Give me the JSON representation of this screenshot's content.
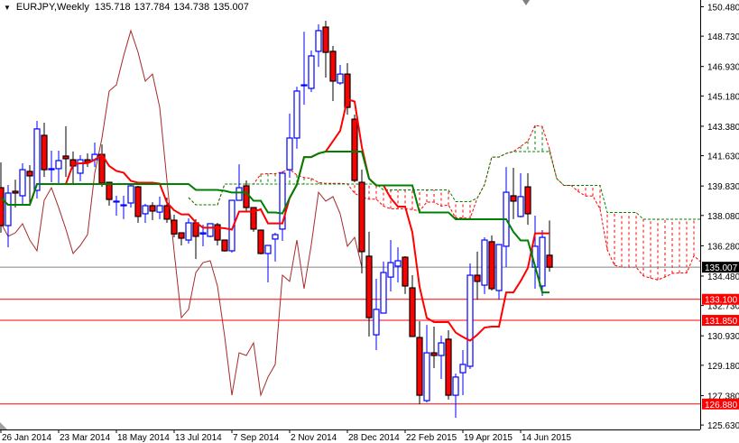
{
  "header": {
    "symbol": "EURJPY,Weekly",
    "open": "135.718",
    "high": "137.784",
    "low": "134.738",
    "close": "135.007"
  },
  "colors": {
    "bull": "#0000ff",
    "bear_fill": "#ff0000",
    "tenkan": "#ff0000",
    "kijun": "#008000",
    "chikou": "#a52a2a",
    "cloud_up": "#008000",
    "cloud_down": "#ff0000",
    "level": "#ff0000",
    "price_line": "#808080"
  },
  "chart_data": {
    "type": "candlestick",
    "title": "EURJPY,Weekly",
    "indicator": "Ichimoku Kinko Hyo",
    "ylim": [
      125.63,
      150.48
    ],
    "y_ticks": [
      "150.480",
      "148.730",
      "146.930",
      "145.180",
      "143.380",
      "141.630",
      "139.830",
      "138.080",
      "136.280",
      "134.480",
      "132.730",
      "130.930",
      "129.180",
      "127.380",
      "125.630"
    ],
    "x_labels": [
      {
        "index": 0,
        "label": "26 Jan 2014"
      },
      {
        "index": 8,
        "label": "23 Mar 2014"
      },
      {
        "index": 16,
        "label": "18 May 2014"
      },
      {
        "index": 24,
        "label": "13 Jul 2014"
      },
      {
        "index": 32,
        "label": "7 Sep 2014"
      },
      {
        "index": 40,
        "label": "2 Nov 2014"
      },
      {
        "index": 48,
        "label": "28 Dec 2014"
      },
      {
        "index": 56,
        "label": "22 Feb 2015"
      },
      {
        "index": 64,
        "label": "19 Apr 2015"
      },
      {
        "index": 72,
        "label": "14 Jun 2015"
      }
    ],
    "current_price": "135.007",
    "levels": [
      "133.100",
      "131.850",
      "126.880"
    ],
    "ohlc": [
      [
        139.73,
        141.23,
        137.05,
        137.48
      ],
      [
        137.48,
        139.89,
        136.19,
        139.41
      ],
      [
        139.52,
        140.21,
        138.55,
        139.41
      ],
      [
        139.25,
        141.18,
        138.71,
        140.8
      ],
      [
        140.7,
        141.07,
        138.66,
        140.43
      ],
      [
        139.57,
        143.7,
        139.09,
        143.22
      ],
      [
        142.84,
        143.59,
        140.37,
        140.8
      ],
      [
        140.8,
        141.93,
        140.05,
        140.86
      ],
      [
        140.86,
        141.93,
        139.89,
        141.34
      ],
      [
        141.61,
        143.38,
        140.37,
        141.45
      ],
      [
        141.39,
        141.88,
        139.99,
        141.02
      ],
      [
        140.59,
        141.66,
        140.11,
        141.39
      ],
      [
        141.39,
        141.77,
        140.96,
        141.23
      ],
      [
        141.39,
        142.41,
        140.96,
        141.71
      ],
      [
        141.71,
        142.3,
        139.78,
        139.99
      ],
      [
        140.05,
        140.05,
        138.66,
        139.03
      ],
      [
        138.93,
        139.25,
        138.07,
        138.93
      ],
      [
        138.71,
        139.25,
        137.86,
        138.71
      ],
      [
        138.82,
        139.99,
        138.55,
        139.84
      ],
      [
        139.78,
        139.84,
        137.64,
        138.02
      ],
      [
        138.18,
        138.77,
        137.64,
        138.66
      ],
      [
        138.66,
        138.87,
        137.8,
        138.34
      ],
      [
        138.28,
        139.2,
        137.86,
        138.66
      ],
      [
        138.66,
        139.14,
        137.64,
        137.86
      ],
      [
        137.8,
        138.12,
        136.78,
        136.98
      ],
      [
        137.05,
        137.05,
        136.3,
        136.73
      ],
      [
        136.62,
        137.91,
        136.41,
        137.64
      ],
      [
        137.64,
        137.86,
        135.5,
        136.84
      ],
      [
        136.98,
        137.53,
        136.25,
        137.05
      ],
      [
        136.84,
        137.59,
        136.78,
        137.59
      ],
      [
        137.53,
        137.64,
        136.3,
        136.62
      ],
      [
        136.62,
        136.62,
        135.93,
        135.98
      ],
      [
        135.98,
        138.98,
        135.87,
        138.98
      ],
      [
        138.98,
        141.12,
        138.98,
        139.73
      ],
      [
        139.84,
        140.16,
        138.28,
        138.55
      ],
      [
        138.55,
        138.55,
        137.11,
        137.27
      ],
      [
        137.21,
        137.21,
        135.77,
        135.82
      ],
      [
        135.82,
        136.3,
        134.1,
        136.3
      ],
      [
        136.68,
        137.05,
        135.34,
        136.94
      ],
      [
        137.27,
        140.7,
        136.57,
        140.59
      ],
      [
        140.8,
        144.13,
        140.32,
        142.68
      ],
      [
        142.68,
        145.73,
        142.04,
        145.47
      ],
      [
        145.79,
        149.0,
        144.66,
        145.84
      ],
      [
        145.63,
        147.88,
        145.41,
        147.56
      ],
      [
        147.83,
        149.43,
        146.91,
        149.06
      ],
      [
        149.27,
        149.65,
        146.27,
        147.77
      ],
      [
        147.83,
        148.15,
        144.88,
        146.06
      ],
      [
        145.95,
        147.02,
        145.84,
        146.48
      ],
      [
        146.48,
        147.13,
        144.07,
        144.5
      ],
      [
        143.8,
        144.07,
        140.05,
        140.16
      ],
      [
        140.05,
        140.8,
        134.64,
        135.93
      ],
      [
        135.66,
        137.11,
        130.89,
        132.01
      ],
      [
        130.99,
        134.32,
        130.08,
        132.5
      ],
      [
        132.28,
        135.34,
        132.28,
        134.69
      ],
      [
        134.42,
        136.62,
        133.57,
        135.28
      ],
      [
        135.07,
        136.19,
        134.1,
        135.39
      ],
      [
        135.6,
        135.66,
        133.41,
        133.89
      ],
      [
        133.78,
        134.53,
        130.89,
        130.89
      ],
      [
        130.83,
        131.8,
        126.87,
        127.4
      ],
      [
        127.08,
        131.58,
        126.97,
        129.92
      ],
      [
        129.92,
        131.48,
        129.01,
        129.76
      ],
      [
        129.76,
        130.94,
        128.37,
        130.51
      ],
      [
        130.73,
        131.26,
        127.14,
        127.4
      ],
      [
        127.4,
        128.69,
        126.06,
        128.48
      ],
      [
        128.74,
        130.08,
        127.4,
        129.23
      ],
      [
        129.12,
        135.23,
        128.96,
        134.53
      ],
      [
        134.53,
        135.93,
        133.08,
        134.16
      ],
      [
        133.94,
        136.78,
        133.41,
        136.62
      ],
      [
        136.52,
        136.89,
        133.62,
        133.73
      ],
      [
        133.62,
        136.35,
        133.08,
        136.35
      ],
      [
        136.25,
        140.96,
        135.01,
        139.46
      ],
      [
        139.25,
        140.91,
        137.86,
        138.93
      ],
      [
        138.02,
        140.59,
        137.96,
        139.2
      ],
      [
        139.78,
        140.59,
        137.53,
        138.18
      ],
      [
        135.01,
        138.07,
        133.73,
        136.25
      ],
      [
        133.89,
        137.21,
        133.3,
        136.78
      ],
      [
        135.718,
        137.784,
        134.738,
        135.007
      ]
    ]
  }
}
